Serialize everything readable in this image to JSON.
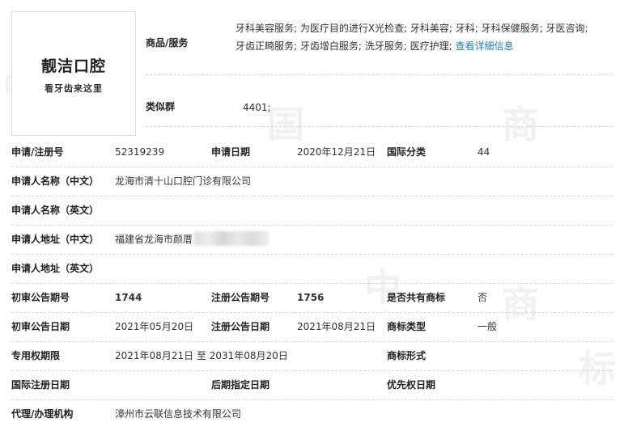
{
  "watermark": [
    "中",
    "国",
    "商",
    "标"
  ],
  "logo": {
    "name": "靓洁口腔",
    "slogan": "看牙齿来这里"
  },
  "goods_services": {
    "label": "商品/服务",
    "line1": "牙科美容服务; 为医疗目的进行X光检查; 牙科美容; 牙科; 牙科保健服务; 牙医咨询;",
    "line2": "牙齿正畸服务; 牙齿增白服务; 洗牙服务; 医疗护理;",
    "link": "查看详细信息"
  },
  "similar_group": {
    "label": "类似群",
    "value": "4401;"
  },
  "fields": {
    "reg_no_label": "申请/注册号",
    "reg_no": "52319239",
    "apply_date_label": "申请日期",
    "apply_date": "2020年12月21日",
    "intl_class_label": "国际分类",
    "intl_class": "44",
    "applicant_cn_label": "申请人名称（中文）",
    "applicant_cn": "龙海市清十山口腔门诊有限公司",
    "applicant_en_label": "申请人名称（英文）",
    "applicant_en": "",
    "address_cn_label": "申请人地址（中文）",
    "address_cn": "福建省龙海市颜厝",
    "address_en_label": "申请人地址（英文）",
    "address_en": "",
    "prelim_no_label": "初审公告期号",
    "prelim_no": "1744",
    "reg_pub_no_label": "注册公告期号",
    "reg_pub_no": "1756",
    "shared_label": "是否共有商标",
    "shared": "否",
    "prelim_date_label": "初审公告日期",
    "prelim_date": "2021年05月20日",
    "reg_pub_date_label": "注册公告日期",
    "reg_pub_date": "2021年08月21日",
    "mark_type_label": "商标类型",
    "mark_type": "一般",
    "exclusive_label": "专用权期限",
    "exclusive": "2021年08月21日 至 2031年08月20日",
    "mark_form_label": "商标形式",
    "mark_form": "",
    "intl_reg_date_label": "国际注册日期",
    "intl_reg_date": "",
    "later_date_label": "后期指定日期",
    "later_date": "",
    "priority_date_label": "优先权日期",
    "priority_date": "",
    "agent_label": "代理/办理机构",
    "agent": "漳州市云联信息技术有限公司"
  }
}
